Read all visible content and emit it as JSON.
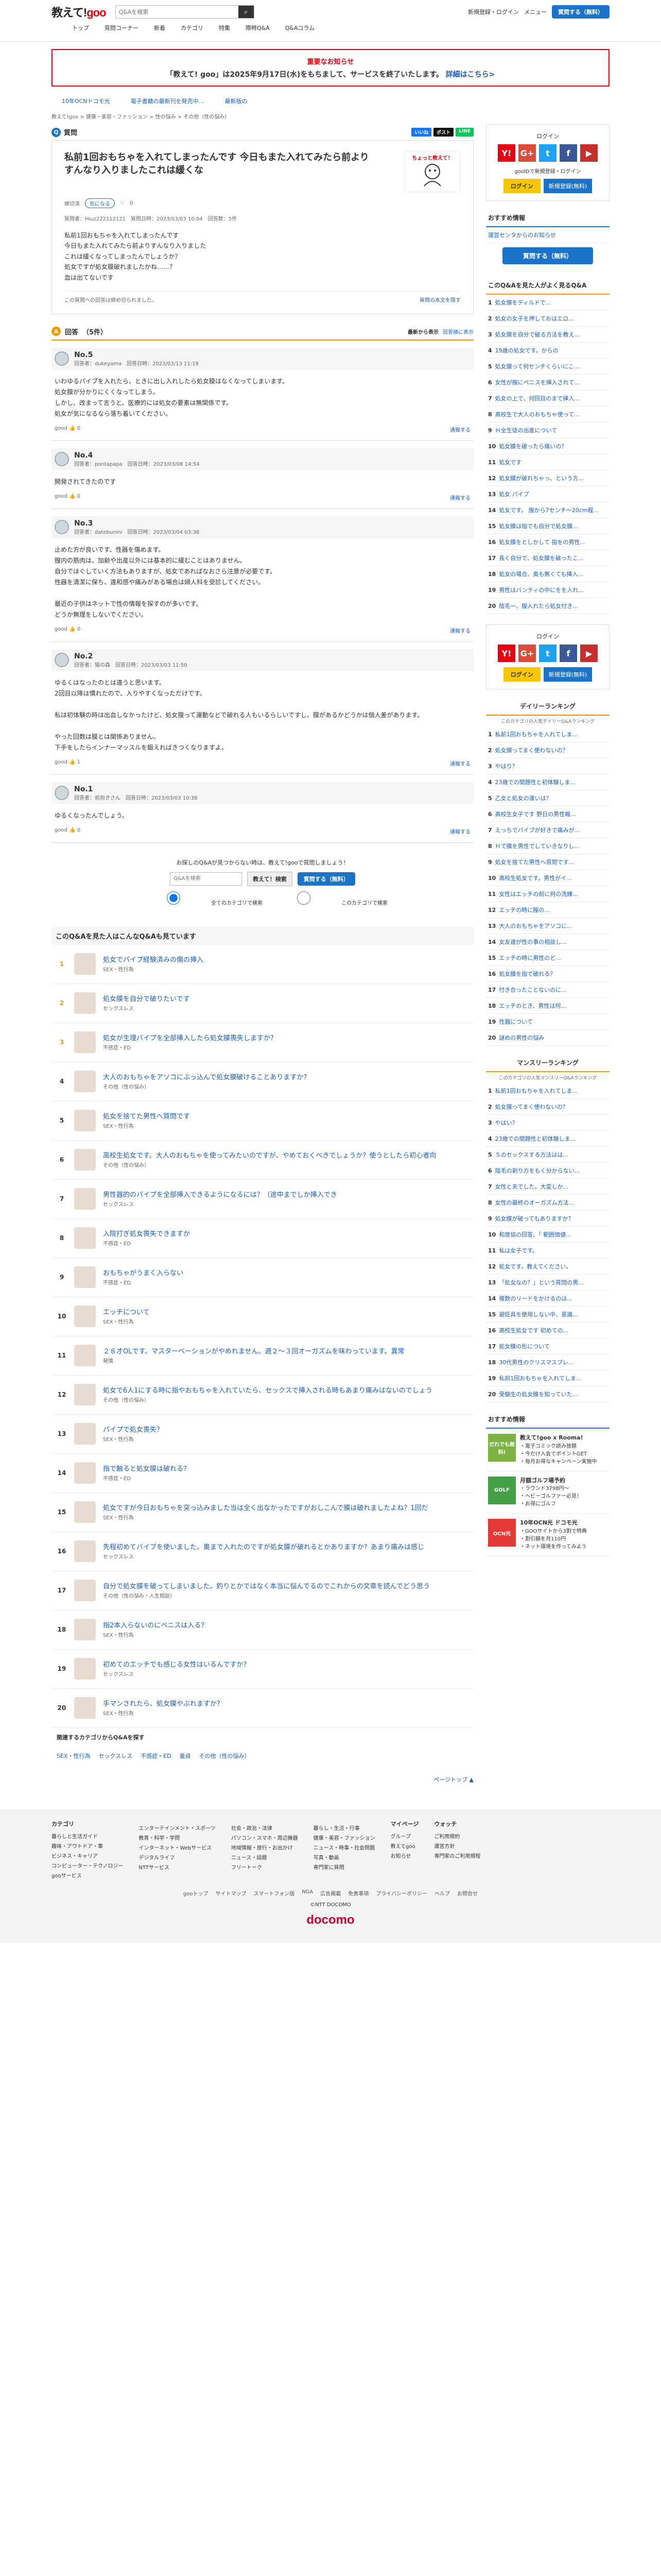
{
  "header": {
    "logo_prefix": "教えて!",
    "logo_brand": "goo",
    "search_placeholder": "Q&Aを検索",
    "links": [
      "新規登録・ログイン",
      "メニュー"
    ],
    "ask_button": "質問する（無料）",
    "nav": [
      "トップ",
      "質問コーナー",
      "新着",
      "カテゴリ",
      "特集",
      "際時Q&A",
      "Q&Aコラム"
    ]
  },
  "notice": {
    "title": "重要なお知らせ",
    "text": "「教えて! goo」は2025年9月17日(水)をもちまして、サービスを終了いたします。",
    "link": "詳細はこちら>"
  },
  "promo": [
    "10年OCNドコモ光",
    "電子書籍の最新刊を発売中…",
    "最新版の"
  ],
  "breadcrumb": "教えて!goo > 健康・美容・ファッション > 性の悩み > その他（性の悩み）",
  "question": {
    "section_label": "質問",
    "badge": "Q",
    "share": [
      "いいね",
      "ポスト",
      "LINE"
    ],
    "title": "私前1回おもちゃを入れてしまったんです 今日もまた入れてみたら前よりすんなり入りましたこれは緩くな",
    "illust_label": "ちょっと教えて！",
    "asker": "締切済",
    "tag": "気になる",
    "count": "0",
    "meta": "質問者：Hiuz222112121　質問日時：2023/03/03 10:04　回答数：5件",
    "body": "私前1回おもちゃを入れてしまったんです\n今日もまた入れてみたら前よりすんなり入りました\nこれは緩くなってしまったんでしょうか？\n処女ですが処女膜破れましたかね……？\n血は出てないです",
    "closed": "この質問への回答は締め切られました。",
    "report": "質問の本文を隠す"
  },
  "answers_header": {
    "label": "回答",
    "count": "（5件）",
    "sort": [
      "最新から表示",
      "回答順に表示"
    ]
  },
  "answers": [
    {
      "no": "No.5",
      "meta": "回答者：dukeyama　回答日時：2023/03/13 11:19",
      "body": "いわゆるパイプを入れたら、ときに出し入れしたら処女膜はなくなってしまいます。\n処女膜が分かりにくくなってしまう。\nしかし、改まって言うと、医療的には処女の要素は無関係です。\n処女が気になるなら落ち着いてください。",
      "good": "good",
      "good_count": "0",
      "report": "通報する"
    },
    {
      "no": "No.4",
      "meta": "回答者：pontapapa　回答日時：2023/03/08 14:54",
      "body": "開発されてきたのです",
      "good": "good",
      "good_count": "0",
      "report": "通報する"
    },
    {
      "no": "No.3",
      "meta": "回答者：datebunini　回答日時：2023/03/04 03:38",
      "body": "止めた方が良いです、性器を傷めます。\n膣内の筋肉は、加齢や出産以外には基本的に緩むことはありません。\n自分でほぐしていく方法もありますが、処女であればなおさら注意が必要です。\n性器を清潔に保ち、違和感や痛みがある場合は婦人科を受診してください。\n\n最近の子供はネットで性の情報を探すのが多いです。\nどうか無理をしないでください。",
      "good": "good",
      "good_count": "0",
      "report": "通報する"
    },
    {
      "no": "No.2",
      "meta": "回答者：猫の森　回答日時：2023/03/03 11:50",
      "body": "ゆるくはなったのとは違うと思います。\n2回目以降は慣れたので、入りやすくなっただけです。\n\n私は初体験の時は出血しなかったけど、処女膜って運動などで破れる人もいるらしいですし、膜があるかどうかは個人差があります。\n\nやった回数は膜とは関係ありません。\n下手をしたらインナーマッスルを鍛えればきつくなりますよ。",
      "good": "good",
      "good_count": "1",
      "report": "通報する"
    },
    {
      "no": "No.1",
      "meta": "回答者：前向きさん　回答日時：2023/03/03 10:38",
      "body": "ゆるくなったんでしょう。",
      "good": "good",
      "good_count": "0",
      "report": "通報する"
    }
  ],
  "ask_cta": {
    "lead": "お探しのQ&Aが見つからない時は、教えて!gooで質問しましょう！",
    "placeholder": "Q&Aを検索",
    "search_button": "教えて！検索",
    "ask_button": "質問する（無料）",
    "radio1": "全てのカテゴリで検索",
    "radio2": "このカテゴリで検索"
  },
  "related": {
    "heading": "このQ&Aを見た人はこんなQ&Aも見ています",
    "items": [
      {
        "rank": "1",
        "title": "処女でパイプ経験済みの傷の挿入",
        "cat": "SEX・性行為"
      },
      {
        "rank": "2",
        "title": "処女膜を自分で破りたいです",
        "cat": "セックスレス"
      },
      {
        "rank": "3",
        "title": "処女が生理パイプを全部挿入したら処女膜喪失しますか？",
        "cat": "不感症・ED"
      },
      {
        "rank": "4",
        "title": "大人のおもちゃをアソコにぶっ込んで処女膜破けることありますか？",
        "cat": "その他（性の悩み）"
      },
      {
        "rank": "5",
        "title": "処女を捨てた男性へ質問です",
        "cat": "SEX・性行為"
      },
      {
        "rank": "6",
        "title": "高校生処女です。大人のおもちゃを使ってみたいのですが、やめておくべきでしょうか？使うとしたら初心者向",
        "cat": "その他（性の悩み）"
      },
      {
        "rank": "7",
        "title": "男性器的のパイプを全部挿入できるようになるには？（途中までしか挿入でき",
        "cat": "セックスレス"
      },
      {
        "rank": "8",
        "title": "入院打ぎ処女喪失できますか",
        "cat": "不感症・ED"
      },
      {
        "rank": "9",
        "title": "おもちゃがうまく入らない",
        "cat": "不感症・ED"
      },
      {
        "rank": "10",
        "title": "エッチについて",
        "cat": "SEX・性行為"
      },
      {
        "rank": "11",
        "title": "２８才OLです。マスターベーションがやめれません。週２〜３回オーガズムを味わっています。異常",
        "cat": "発情"
      },
      {
        "rank": "12",
        "title": "処女で6人1にする時に指やおもちゃを入れていたら、セックスで挿入される時もあまり痛みはないのでしょう",
        "cat": "その他（性の悩み）"
      },
      {
        "rank": "13",
        "title": "パイプで処女喪失？",
        "cat": "SEX・性行為"
      },
      {
        "rank": "14",
        "title": "指で触ると処女膜は破れる？",
        "cat": "不感症・ED"
      },
      {
        "rank": "15",
        "title": "処女ですが今日おもちゃを突っ込みました当は全く出なかったですがおしこんで膜は破れましたよね？1回だ",
        "cat": "SEX・性行為"
      },
      {
        "rank": "16",
        "title": "先程初めてバイブを使いました。奥まで入れたのですが処女膜が破れるとかありますか？あまり痛みは感じ",
        "cat": "セックスレス"
      },
      {
        "rank": "17",
        "title": "自分で処女膜を破ってしまいました。釣りとかではなく本当に悩んでるのでこれからの文章を読んでどう思う",
        "cat": "その他（性の悩み・人生相談）"
      },
      {
        "rank": "18",
        "title": "指2本入らないのにペニスは入る？",
        "cat": "SEX・性行為"
      },
      {
        "rank": "19",
        "title": "初めてのエッチでも感じる女性はいるんですか？",
        "cat": "セックスレス"
      },
      {
        "rank": "20",
        "title": "手マンされたら、処女膜やぶれますか？",
        "cat": "SEX・性行為"
      }
    ]
  },
  "catlinks_label": "関連するカテゴリからQ&Aを探す",
  "catlinks": [
    "SEX・性行為",
    "セックスレス",
    "不感症・ED",
    "童貞",
    "その他（性の悩み）"
  ],
  "pagetop": "ページトップ",
  "side": {
    "login_title": "ログイン",
    "goo_id": "gooIDで新規登録・ログイン",
    "login_btn": "ログイン",
    "register_btn": "新規登録(無料)",
    "recommend_heading": "おすすめ情報",
    "recommend_link": "運営センタからのお知らせ",
    "ask_btn": "質問する（無料）",
    "viewed_heading": "このQ&Aを見た人がよく見るQ&A",
    "viewed": [
      "処女膜をディルドで...",
      "処女の女子を押しておはエロ...",
      "処女膜を自分で破る方法を教え...",
      "19歳の処女です。からの",
      "処女膜って何センチくらいにこ...",
      "女性が膣にペニスを挿入されて...",
      "処女の上で、何回目のまで挿入...",
      "高校生で大人のおもちゃ使って...",
      "Ｈ全生徒の出産について",
      "処女膜を破ったら痛いの？",
      "処女です",
      "処女膜が破れちゃっ、という方...",
      "処女 パイプ",
      "処女です。 膣から7センチ〜20cm程...",
      "処女膜は指でも自分で処女膜...",
      "処女膜をとしかして 指をの男性...",
      "長く自分で、処女膜を破ったこ...",
      "処女の場合、奥も無くても挿入...",
      "男性はバンティの中にをを入れ...",
      "陰毛ー、膣入れたら処女付き..."
    ],
    "login2_title": "ログイン",
    "daily_heading": "デイリーランキング",
    "daily_sub": "このカテゴリの人気デイリーQ&Aランキング",
    "daily": [
      "私前1回おもちゃを入れてしま...",
      "処女膜ってまく使わないの？",
      "やはり？",
      "23歳での間題性と初体験しま...",
      "乙女と処女の違いは？",
      "高校生女子です 野日の男性報...",
      "えっちでパイプが好きで痛みが...",
      "Ｈで膜を男性でしていきなりし...",
      "処女を捨てた男性へ質問です...",
      "高校生処女です。男性がイ...",
      "女性はエッチの前に何の洗練...",
      "エッチの時に膣の...",
      "大人のおもちゃをアソコに...",
      "女友達が性の事の相談し...",
      "エッチの時に男性のど...",
      "処女膜を指で破れる？",
      "付き合ったことないのに...",
      "エッチのとき、男性は何...",
      "性器について",
      "謎めの男性の悩み"
    ],
    "monthly_heading": "マンスリーランキング",
    "monthly_sub": "このカテゴリの人気マンスリーQ&Aランキング",
    "monthly": [
      "私前1回おもちゃを入れてしま...",
      "処女膜ってまく使わないの？",
      "やはい？",
      "23歳での間題性と初体験しま...",
      "Ｓのセックスする方法はは...",
      "陰毛の剃り方をもく分からない...",
      "女性と夫でした。大変しか...",
      "女性の最終のオーガズム方法...",
      "処女膜が破ってもありますか？",
      "和度協の回答、「 範囲価値...",
      "私は女子です。",
      "処女です。教えてください。",
      "「処女なの？」という質問の男...",
      "複数のリードをかけるのは...",
      "避妊具を使用しない中、意識...",
      "高校生処女です 初めての...",
      "処女膜の形について",
      "30代男性のクリスマスプレ...",
      "私前1回おもちゃを入れてしま...",
      "受験生の処女膜を知っていた..."
    ],
    "ad_heading": "おすすめ情報",
    "ads": [
      {
        "img": "だれでも無料!",
        "title": "教えて!goo x Rooma!",
        "lines": [
          "・電子コミック読み放題",
          "・今だけ入会でポイントGET",
          "・毎月お得なキャンペーン実施中"
        ]
      },
      {
        "img": "GOLF",
        "title": "月額ゴルフ場予約",
        "lines": [
          "・ラウンド3798円〜",
          "・ヘビーゴルファー必見！",
          "・お得にゴルフ"
        ]
      },
      {
        "img": "OCN光",
        "title": "10年OCN光 ドコモ光",
        "lines": [
          "・GOOサイトから3割で特典",
          "・割引額を月110円",
          "・ネット環境を作ってみよう"
        ]
      }
    ]
  },
  "footer": {
    "cols": [
      {
        "h": "カテゴリ",
        "items": [
          "暮らしと生活ガイド",
          "趣味・アウトドア・車",
          "ビジネス・キャリア",
          "コンピューター・テクノロジー",
          "gooサービス"
        ]
      },
      {
        "h": "",
        "items": [
          "エンターテインメント・スポーツ",
          "教育・科学・学問",
          "インターネット・Webサービス",
          "デジタルライフ",
          "NTTサービス"
        ]
      },
      {
        "h": "",
        "items": [
          "社会・政治・法律",
          "パソコン・スマホ・周辺機器",
          "地域情報・旅行・お出かけ",
          "ニュース・話題",
          "フリートーク"
        ]
      },
      {
        "h": "",
        "items": [
          "暮らし・生活・行事",
          "健康・美容・ファッション",
          "ニュース・時事・社会問題",
          "写真・動画",
          "専門家に質問"
        ]
      },
      {
        "h": "マイページ",
        "items": [
          "グループ",
          "教えてgoo",
          "お知らせ"
        ]
      },
      {
        "h": "ウォッチ",
        "items": [
          "ご利用規約",
          "運営方針",
          "専門家のご利用規程"
        ]
      }
    ],
    "links": [
      "gooトップ",
      "サイトマップ",
      "スマートフォン版",
      "NGA",
      "広告掲載",
      "免責事項",
      "プライバシーポリシー",
      "ヘルプ",
      "お問合せ"
    ],
    "copy": "©NTT DOCOMO",
    "brand": "docomo"
  }
}
